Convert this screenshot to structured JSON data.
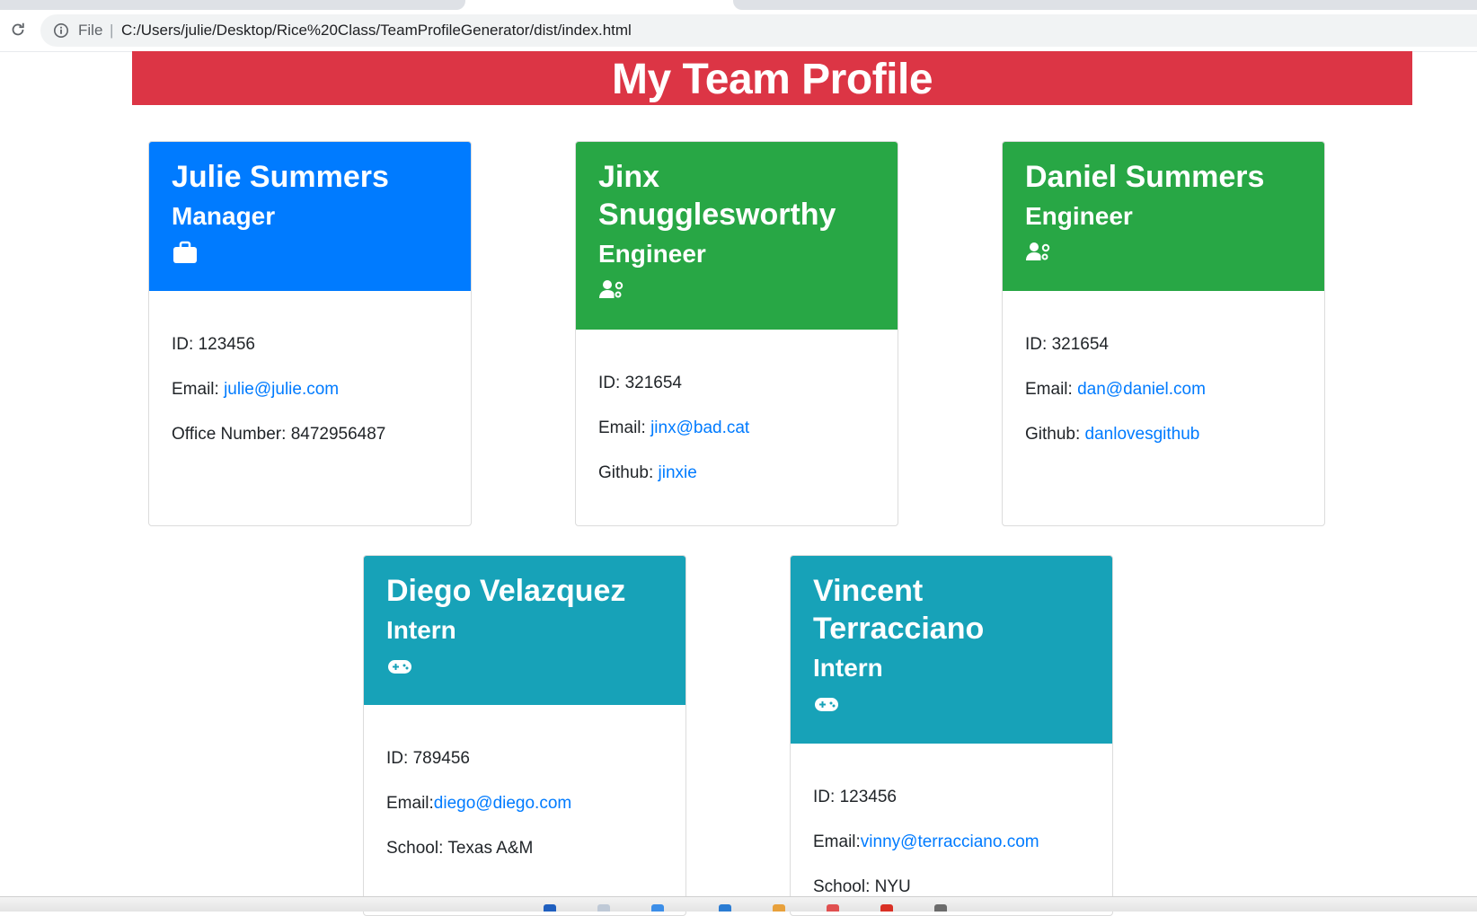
{
  "browser": {
    "scheme_label": "File",
    "separator": "|",
    "url": "C:/Users/julie/Desktop/Rice%20Class/TeamProfileGenerator/dist/index.html"
  },
  "page": {
    "title": "My Team Profile"
  },
  "labels": {
    "id": "ID: ",
    "email": "Email: ",
    "email_nospace": "Email:",
    "office": "Office Number: ",
    "github": "Github: ",
    "school": "School: "
  },
  "team": [
    {
      "name": "Julie Summers",
      "role": "Manager",
      "icon": "briefcase-icon",
      "color": "#007bff",
      "id": "123456",
      "email": "julie@julie.com",
      "office_number": "8472956487"
    },
    {
      "name": "Jinx Snugglesworthy",
      "role": "Engineer",
      "icon": "users-cog-icon",
      "color": "#28a745",
      "id": "321654",
      "email": "jinx@bad.cat",
      "github": "jinxie"
    },
    {
      "name": "Daniel Summers",
      "role": "Engineer",
      "icon": "users-cog-icon",
      "color": "#28a745",
      "id": "321654",
      "email": "dan@daniel.com",
      "github": "danlovesgithub"
    },
    {
      "name": "Diego Velazquez",
      "role": "Intern",
      "icon": "gamepad-icon",
      "color": "#17a2b8",
      "id": "789456",
      "email": "diego@diego.com",
      "school": "Texas A&M"
    },
    {
      "name": "Vincent Terracciano",
      "role": "Intern",
      "icon": "gamepad-icon",
      "color": "#17a2b8",
      "id": "123456",
      "email": "vinny@terracciano.com",
      "school": "NYU"
    }
  ]
}
